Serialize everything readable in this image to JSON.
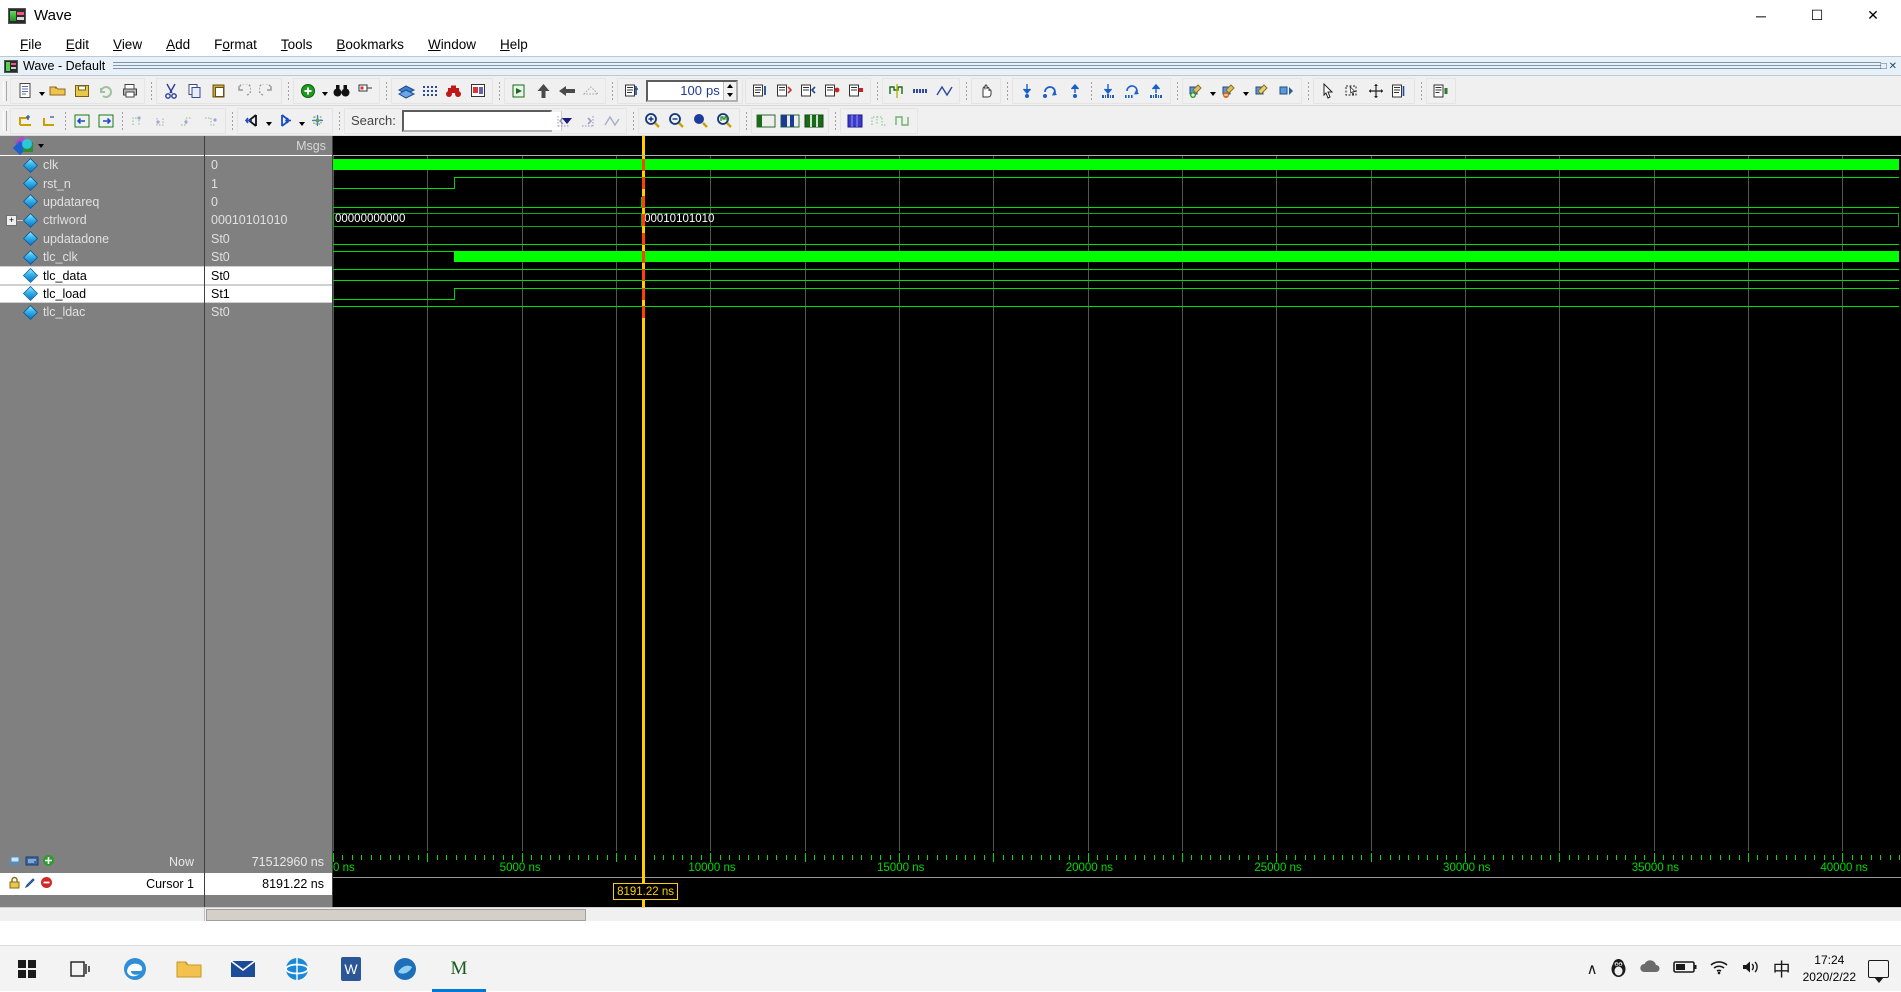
{
  "window": {
    "title": "Wave",
    "app_icon": "wave-window-icon",
    "minimize_label": "─",
    "maximize_label": "☐",
    "close_label": "✕"
  },
  "menubar": {
    "items": [
      {
        "label": "File",
        "mnemonic": "F"
      },
      {
        "label": "Edit",
        "mnemonic": "E"
      },
      {
        "label": "View",
        "mnemonic": "V"
      },
      {
        "label": "Add",
        "mnemonic": "A"
      },
      {
        "label": "Format",
        "mnemonic": "o"
      },
      {
        "label": "Tools",
        "mnemonic": "T"
      },
      {
        "label": "Bookmarks",
        "mnemonic": "B"
      },
      {
        "label": "Window",
        "mnemonic": "W"
      },
      {
        "label": "Help",
        "mnemonic": "H"
      }
    ]
  },
  "dock": {
    "label": "Wave - Default",
    "icon": "wave-dock-icon",
    "undock_icon": "undock-icon",
    "close_icon": "close-icon"
  },
  "toolbar_row1": {
    "groups": [
      {
        "name": "file-group",
        "buttons": [
          {
            "name": "new-file-icon",
            "dropdown": true
          },
          {
            "name": "open-folder-icon"
          },
          {
            "name": "save-icon"
          },
          {
            "name": "reload-icon"
          },
          {
            "name": "print-icon"
          }
        ]
      },
      {
        "name": "edit-group",
        "buttons": [
          {
            "name": "cut-icon"
          },
          {
            "name": "copy-icon"
          },
          {
            "name": "paste-icon"
          },
          {
            "name": "undo-icon"
          },
          {
            "name": "redo-icon"
          }
        ]
      },
      {
        "name": "insert-group",
        "buttons": [
          {
            "name": "add-object-icon",
            "dropdown": true
          },
          {
            "name": "find-binoculars-icon"
          },
          {
            "name": "collapse-tree-icon"
          }
        ]
      },
      {
        "name": "sim-group",
        "buttons": [
          {
            "name": "compile-layers-icon"
          },
          {
            "name": "simulate-grid-icon"
          },
          {
            "name": "run-all-icon"
          },
          {
            "name": "break-icon"
          }
        ]
      },
      {
        "name": "run-group",
        "buttons": [
          {
            "name": "restart-icon"
          },
          {
            "name": "run-icon"
          },
          {
            "name": "continue-run-icon"
          },
          {
            "name": "run-all-waves-icon"
          }
        ]
      },
      {
        "name": "runlength-group",
        "buttons": [
          {
            "name": "step-icon"
          }
        ],
        "spinner": {
          "name": "run-length-spinner",
          "value": "100",
          "unit": "ps"
        }
      },
      {
        "name": "step-group",
        "buttons": [
          {
            "name": "step-into-icon"
          },
          {
            "name": "step-over-icon"
          },
          {
            "name": "step-out-icon"
          },
          {
            "name": "continue-icon"
          },
          {
            "name": "stop-icon"
          }
        ]
      },
      {
        "name": "wave-tool-group",
        "buttons": [
          {
            "name": "insert-cursor-icon"
          },
          {
            "name": "wave-expand-icon"
          },
          {
            "name": "wave-compare-icon"
          }
        ]
      },
      {
        "name": "bookmark-group",
        "buttons": [
          {
            "name": "drag-hand-icon"
          }
        ]
      },
      {
        "name": "cursor-group",
        "buttons": [
          {
            "name": "cursor-down-icon"
          },
          {
            "name": "cursor-rotate-icon"
          },
          {
            "name": "cursor-up-icon"
          },
          {
            "name": "wave-down-icon"
          },
          {
            "name": "wave-rotate-icon"
          },
          {
            "name": "wave-up-icon"
          }
        ]
      },
      {
        "name": "bookmark2-group",
        "buttons": [
          {
            "name": "bookmark-add-icon",
            "dropdown": true
          },
          {
            "name": "bookmark-remove-icon",
            "dropdown": true
          },
          {
            "name": "bookmark-clear-icon",
            "dropdown": true
          },
          {
            "name": "bookmark-goto-icon"
          }
        ]
      },
      {
        "name": "select-group",
        "buttons": [
          {
            "name": "select-mode-icon"
          },
          {
            "name": "zoom-mode-icon"
          },
          {
            "name": "pan-mode-icon"
          },
          {
            "name": "edit-mode-icon"
          }
        ]
      },
      {
        "name": "last-group",
        "buttons": [
          {
            "name": "properties-icon"
          }
        ]
      }
    ]
  },
  "toolbar_row2": {
    "groups": [
      {
        "name": "wave-edit-group",
        "buttons": [
          {
            "name": "insert-signal-icon"
          },
          {
            "name": "delete-signal-icon"
          },
          {
            "name": "prev-edge-icon"
          },
          {
            "name": "next-edge-icon"
          },
          {
            "name": "wave-dot1-icon"
          },
          {
            "name": "wave-dot2-icon"
          },
          {
            "name": "wave-dot3-icon"
          },
          {
            "name": "wave-dot4-icon"
          }
        ]
      },
      {
        "name": "expand-group",
        "buttons": [
          {
            "name": "expand-left-icon",
            "dropdown": true
          },
          {
            "name": "expand-right-icon",
            "dropdown": true
          },
          {
            "name": "expand-all-icon"
          }
        ]
      },
      {
        "name": "search-group",
        "search": {
          "name": "search-input",
          "label": "Search:",
          "value": "",
          "placeholder": "",
          "dropdown_icon": "chevron-down-icon",
          "buttons": [
            {
              "name": "search-prev-icon"
            },
            {
              "name": "search-next-icon"
            },
            {
              "name": "search-options-icon"
            }
          ]
        }
      },
      {
        "name": "zoom-group",
        "buttons": [
          {
            "name": "zoom-in-icon"
          },
          {
            "name": "zoom-out-icon"
          },
          {
            "name": "zoom-full-icon"
          },
          {
            "name": "zoom-cursor-icon"
          }
        ]
      },
      {
        "name": "layout-group",
        "buttons": [
          {
            "name": "layout-left-icon"
          },
          {
            "name": "layout-split-icon"
          },
          {
            "name": "layout-grid-icon"
          }
        ]
      },
      {
        "name": "grid-group",
        "buttons": [
          {
            "name": "grid-toggle-icon"
          },
          {
            "name": "grid-lines-icon"
          },
          {
            "name": "grid-snap-icon"
          }
        ]
      }
    ]
  },
  "wave_panel": {
    "names_header": {
      "icon": "palette-icon",
      "dropdown_icon": "chevron-down-icon"
    },
    "values_header": "Msgs",
    "signals": [
      {
        "name": "clk",
        "value": "0",
        "expandable": false,
        "selected": false,
        "type": "clock"
      },
      {
        "name": "rst_n",
        "value": "1",
        "expandable": false,
        "selected": false,
        "type": "bit"
      },
      {
        "name": "updatareq",
        "value": "0",
        "expandable": false,
        "selected": false,
        "type": "bit"
      },
      {
        "name": "ctrlword",
        "value": "00010101010",
        "expandable": true,
        "selected": false,
        "type": "bus"
      },
      {
        "name": "updatadone",
        "value": "St0",
        "expandable": false,
        "selected": false,
        "type": "bit"
      },
      {
        "name": "tlc_clk",
        "value": "St0",
        "expandable": false,
        "selected": false,
        "type": "clock"
      },
      {
        "name": "tlc_data",
        "value": "St0",
        "expandable": false,
        "selected": true,
        "type": "bit"
      },
      {
        "name": "tlc_load",
        "value": "St1",
        "expandable": false,
        "selected": true,
        "type": "bit"
      },
      {
        "name": "tlc_ldac",
        "value": "St0",
        "expandable": false,
        "selected": false,
        "type": "bit"
      }
    ],
    "bus_values": [
      "00000000000",
      "00010101010"
    ],
    "colors": {
      "wave_background": "#000000",
      "wave_signal": "#00ff00",
      "panel_background": "#808080",
      "cursor": "#ffd000",
      "cursor_marker": "#ff4000",
      "grid": "#555555"
    }
  },
  "status": {
    "now_label": "Now",
    "now_value": "71512960 ns",
    "cursor_label": "Cursor 1",
    "cursor_value": "8191.22 ns",
    "now_icons": [
      "save-wave-icon",
      "expand-wave-icon",
      "add-cursor-icon"
    ],
    "cursor_icons": [
      "lock-icon",
      "edit-cursor-icon",
      "delete-cursor-icon"
    ]
  },
  "timeline": {
    "labels": [
      "0 ns",
      "5000 ns",
      "10000 ns",
      "15000 ns",
      "20000 ns",
      "25000 ns",
      "30000 ns",
      "35000 ns",
      "40000 ns"
    ],
    "label_values": [
      0,
      5000,
      10000,
      15000,
      20000,
      25000,
      30000,
      35000,
      40000
    ],
    "unit": "ns",
    "range_start": 0,
    "range_end": 41500,
    "cursor_flag": "8191.22 ns",
    "cursor_time": 8191.22
  },
  "taskbar": {
    "items": [
      {
        "name": "start-button",
        "icon": "windows-logo-icon"
      },
      {
        "name": "task-view-button",
        "icon": "task-view-icon"
      },
      {
        "name": "taskbar-edge",
        "icon": "edge-browser-icon"
      },
      {
        "name": "taskbar-explorer",
        "icon": "file-explorer-icon"
      },
      {
        "name": "taskbar-mail",
        "icon": "mail-icon"
      },
      {
        "name": "taskbar-ie",
        "icon": "internet-explorer-icon"
      },
      {
        "name": "taskbar-word",
        "icon": "word-icon"
      },
      {
        "name": "taskbar-app",
        "icon": "blue-app-icon"
      },
      {
        "name": "taskbar-modelsim",
        "icon": "modelsim-icon"
      }
    ],
    "tray": {
      "chevron": "∧",
      "qq": "qq-penguin-icon",
      "cloud": "onedrive-icon",
      "battery": "battery-icon",
      "wifi": "wifi-icon",
      "volume": "volume-icon",
      "ime": "中",
      "time": "17:24",
      "date": "2020/2/22",
      "notifications": "notification-icon"
    }
  }
}
